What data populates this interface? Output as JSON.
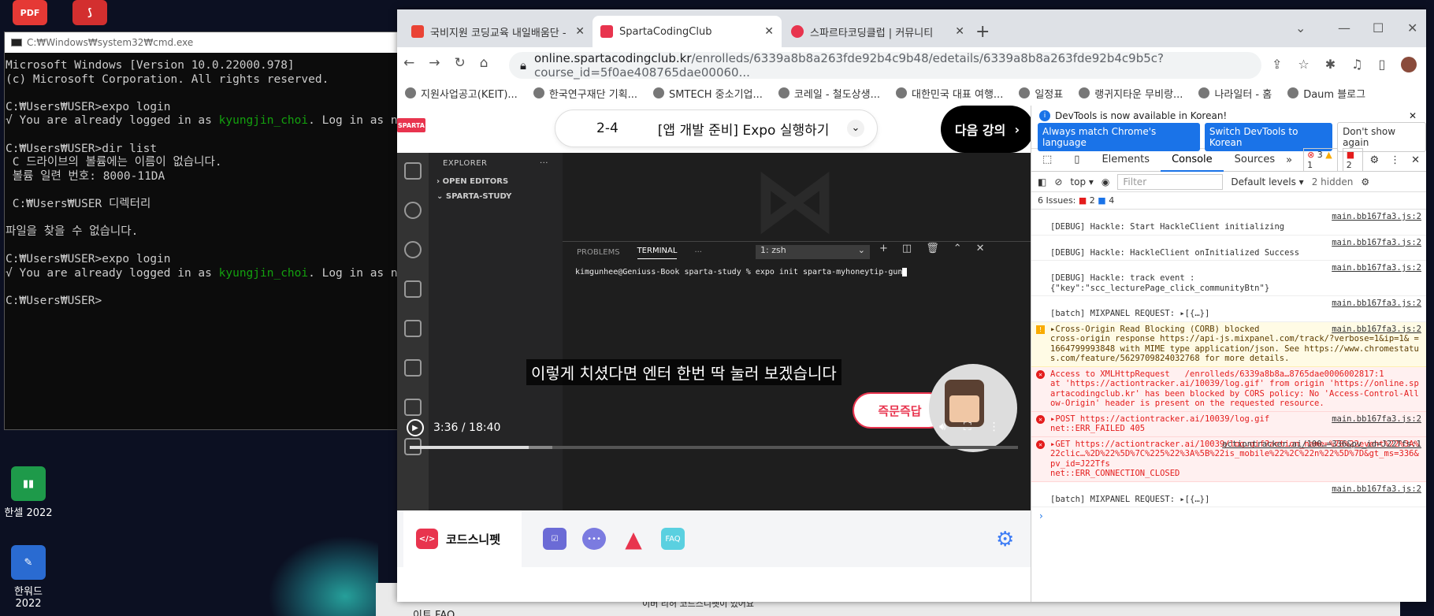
{
  "desktop": {
    "icons": [
      {
        "label": "",
        "name": "pdf-icon"
      },
      {
        "label": "",
        "name": "acrobat-icon"
      },
      {
        "label": "한셀 2022",
        "name": "hancell-icon"
      },
      {
        "label": "한워드 2022",
        "name": "hanword-icon"
      }
    ],
    "behind_text_1": "이트 FAQ",
    "behind_text_2": "이버 리허 코드스니펫이 있어요"
  },
  "cmd": {
    "title": "C:₩Windows₩system32₩cmd.exe",
    "lines": [
      {
        "t": "Microsoft Windows [Version 10.0.22000.978]"
      },
      {
        "t": "(c) Microsoft Corporation. All rights reserved."
      },
      {
        "t": ""
      },
      {
        "t": "C:₩Users₩USER>expo login"
      },
      {
        "t": "√ You are already logged in as ",
        "g": "kyungjin_choi",
        "t2": ". Log in as new u"
      },
      {
        "t": ""
      },
      {
        "t": "C:₩Users₩USER>dir list"
      },
      {
        "t": " C 드라이브의 볼륨에는 이름이 없습니다."
      },
      {
        "t": " 볼륨 일련 번호: 8000-11DA"
      },
      {
        "t": ""
      },
      {
        "t": " C:₩Users₩USER 디렉터리"
      },
      {
        "t": ""
      },
      {
        "t": "파일을 찾을 수 없습니다."
      },
      {
        "t": ""
      },
      {
        "t": "C:₩Users₩USER>expo login"
      },
      {
        "t": "√ You are already logged in as ",
        "g": "kyungjin_choi",
        "t2": ". Log in as new u"
      },
      {
        "t": ""
      },
      {
        "t": "C:₩Users₩USER>"
      }
    ]
  },
  "browser": {
    "tabs": [
      {
        "label": "국비지원 코딩교육 내일배움단 -",
        "color": "#ea4335"
      },
      {
        "label": "SpartaCodingClub",
        "color": "#e8344e"
      },
      {
        "label": "스파르타코딩클럽 | 커뮤니티",
        "color": "#e8344e"
      }
    ],
    "url_host": "online.spartacodingclub.kr",
    "url_rest": "/enrolleds/6339a8b8a263fde92b4c9b48/edetails/6339a8b8a263fde92b4c9b5c?course_id=5f0ae408765dae00060...",
    "bookmarks": [
      "지원사업공고(KEIT)...",
      "한국연구재단 기획...",
      "SMTECH 중소기업...",
      "코레일 - 철도상생...",
      "대한민국 대표 여행...",
      "일정표",
      "랭귀지타운 무비랑...",
      "나라일터 - 홈",
      "Daum 블로그"
    ]
  },
  "lecture": {
    "logo": "SPARTA",
    "number": "2-4",
    "title": "[앱 개발 준비] Expo 실행하기",
    "next": "다음 강의",
    "explorer": "EXPLORER",
    "open_editors": "OPEN EDITORS",
    "project": "SPARTA-STUDY",
    "term_tabs": [
      "PROBLEMS",
      "TERMINAL",
      "···"
    ],
    "term_select": "1: zsh",
    "term_cmd": "kimgunhee@Geniuss-Book sparta-study % expo init sparta-myhoneytip-gun",
    "caption": "이렇게 치셨다면 엔터 한번 딱 눌러 보겠습니다",
    "instant": "즉문즉답",
    "time": "3:36 / 18:40",
    "progress": 0.196,
    "buffered": 0.234,
    "tools": [
      "코드스니펫"
    ],
    "faq": "FAQ"
  },
  "devtools": {
    "notice": "DevTools is now available in Korean!",
    "btn1": "Always match Chrome's language",
    "btn2": "Switch DevTools to Korean",
    "btn3": "Don't show again",
    "tabs": [
      "Elements",
      "Console",
      "Sources"
    ],
    "err_count": "3",
    "warn_count": "1",
    "issue_count": "2",
    "top": "top",
    "filter_placeholder": "Filter",
    "levels": "Default levels",
    "hidden": "2 hidden",
    "issues_label": "6 Issues:",
    "issues_err": "2",
    "issues_info": "4",
    "logs": [
      {
        "type": "",
        "text": "[DEBUG] Hackle: Start HackleClient initializing",
        "src": "main.bb167fa3.js:2"
      },
      {
        "type": "",
        "text": "[DEBUG] Hackle: HackleClient onInitialized Success",
        "src": "main.bb167fa3.js:2"
      },
      {
        "type": "",
        "text": "[DEBUG] Hackle: track event :\n{\"key\":\"scc_lecturePage_click_communityBtn\"}",
        "src": "main.bb167fa3.js:2"
      },
      {
        "type": "",
        "text": "[batch] MIXPANEL REQUEST: ▸[{…}]",
        "src": "main.bb167fa3.js:2"
      },
      {
        "type": "warn",
        "text": "▸Cross-Origin Read Blocking (CORB) blocked\ncross-origin response https://api-js.mixpanel.com/track/?verbose=1&ip=1& =1664799993848 with MIME type application/json. See https://www.chromestatus.com/feature/5629709824032768 for more details.",
        "src": "main.bb167fa3.js:2"
      },
      {
        "type": "err",
        "text": "Access to XMLHttpRequest   /enrolleds/6339a8b8a…8765dae0006002817:1\nat 'https://actiontracker.ai/10039/log.gif' from origin 'https://online.spartacodingclub.kr' has been blocked by CORS policy: No 'Access-Control-Allow-Origin' header is present on the requested resource.",
        "src": ""
      },
      {
        "type": "err",
        "text": "▸POST https://actiontracker.ai/10039/log.gif\nnet::ERR_FAILED 405",
        "src": "main.bb167fa3.js:2"
      },
      {
        "type": "err",
        "text": "▸GET https://actiontracker.ai/10039/log.gif?action_name=%7B%22event%22%3A%22clic…%2D%22%5D%7C%225%22%3A%5B%22is_mobile%22%2C%22n%22%5D%7D&gt_ms=336&pv_id=J22Tfs\nnet::ERR_CONNECTION_CLOSED",
        "src": "actiontracker.ai/100…=336&pv_id=J22Tfs:1"
      },
      {
        "type": "",
        "text": "[batch] MIXPANEL REQUEST: ▸[{…}]",
        "src": "main.bb167fa3.js:2"
      }
    ]
  }
}
